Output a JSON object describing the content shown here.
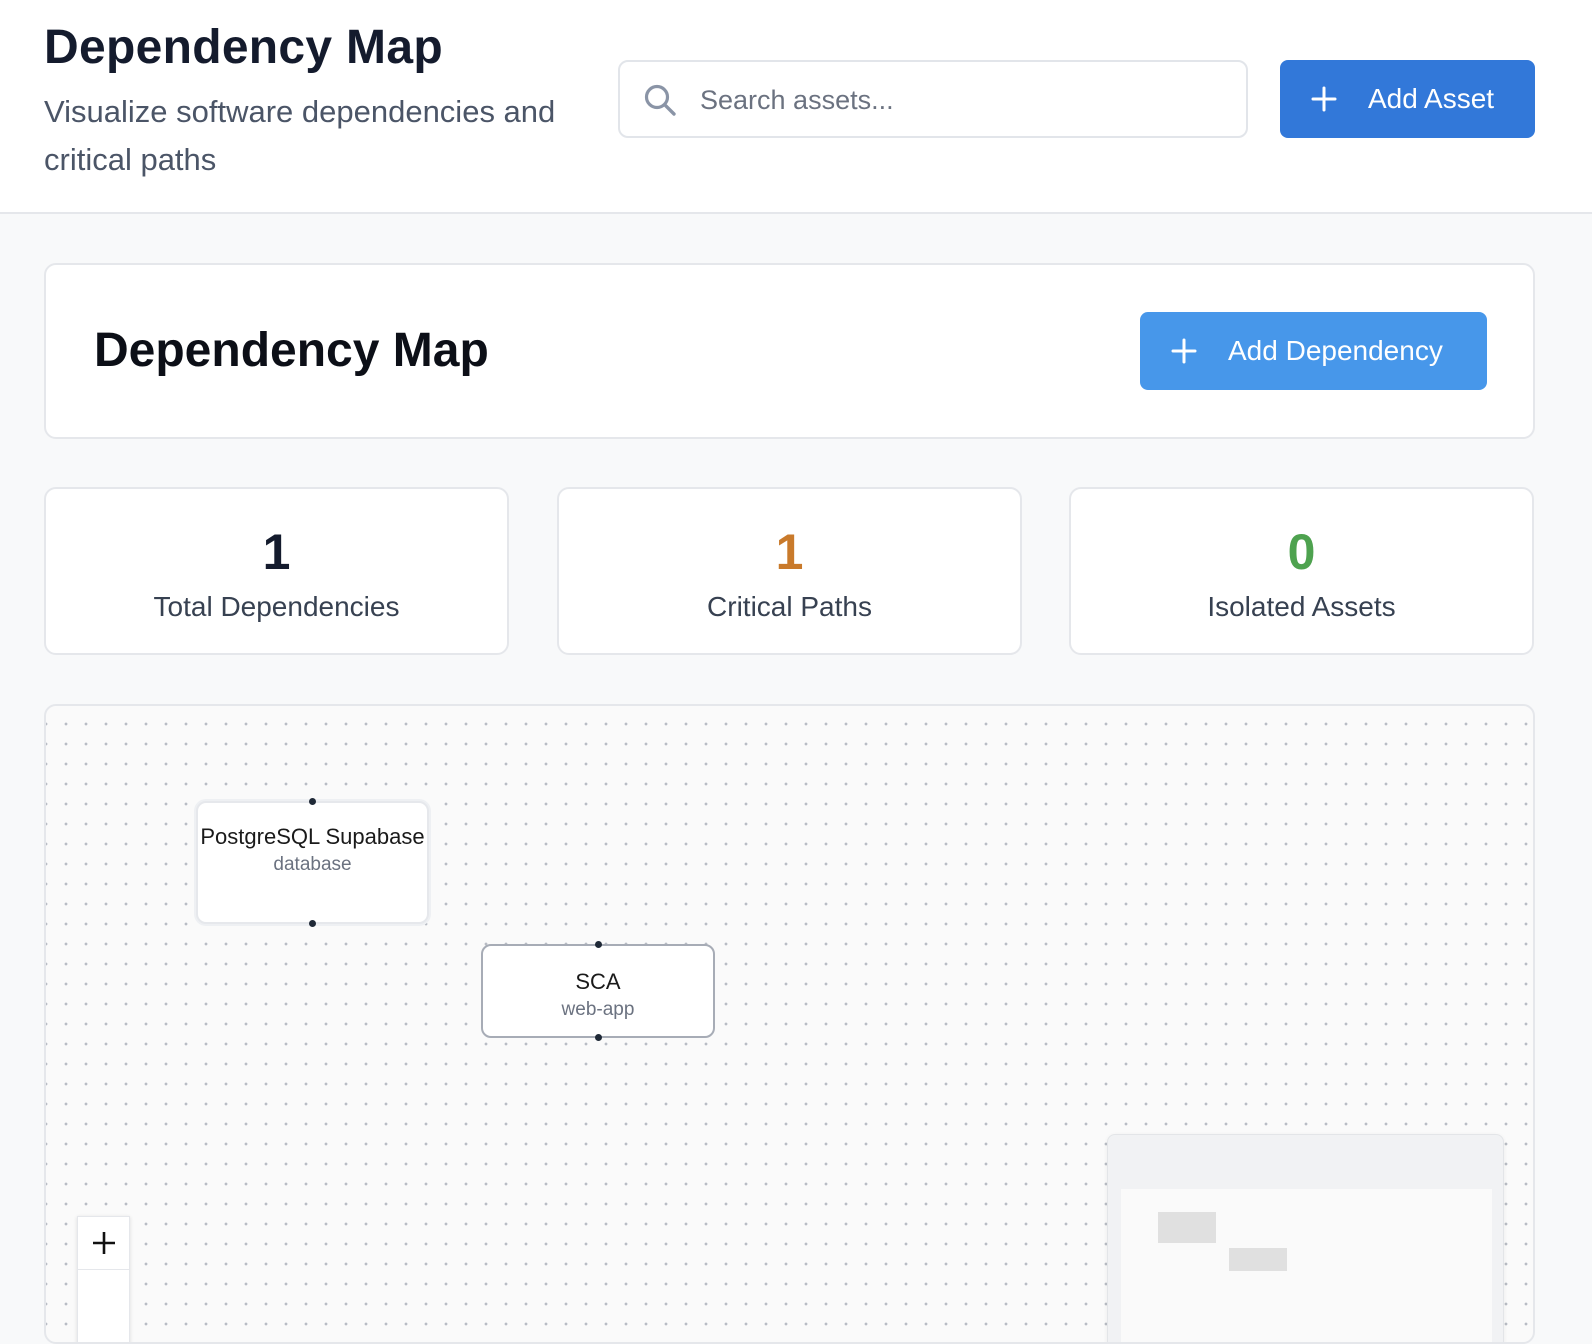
{
  "header": {
    "title": "Dependency Map",
    "subtitle": "Visualize software dependencies and critical paths",
    "search_placeholder": "Search assets...",
    "add_asset_label": "Add Asset"
  },
  "section": {
    "title": "Dependency Map",
    "add_dependency_label": "Add Dependency"
  },
  "stats": [
    {
      "value": "1",
      "label": "Total Dependencies",
      "color": "#141b2d"
    },
    {
      "value": "1",
      "label": "Critical Paths",
      "color": "#c97a2b"
    },
    {
      "value": "0",
      "label": "Isolated Assets",
      "color": "#4ea24f"
    }
  ],
  "canvas": {
    "nodes": [
      {
        "name": "PostgreSQL Supabase",
        "type": "database"
      },
      {
        "name": "SCA",
        "type": "web-app"
      }
    ],
    "controls": {
      "zoom_in_icon": "plus-icon"
    },
    "minimap": true
  },
  "colors": {
    "primary": "#3278d9",
    "primary_light": "#4797ea",
    "warning": "#c97a2b",
    "success": "#4ea24f"
  }
}
